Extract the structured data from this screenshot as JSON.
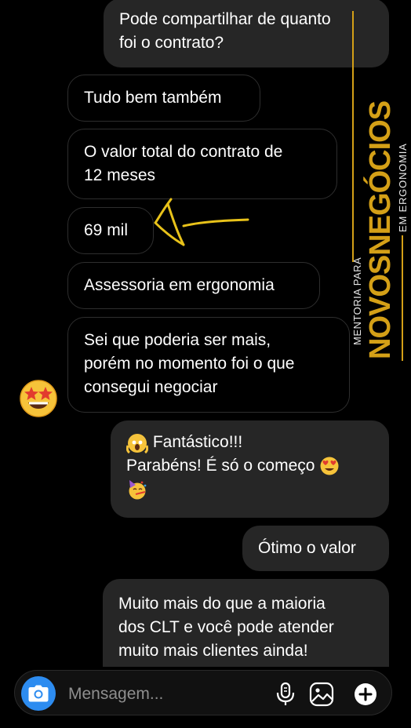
{
  "messages": [
    {
      "id": "m1",
      "side": "out",
      "lines": [
        "Pode compartilhar de quanto",
        "foi o contrato?"
      ]
    },
    {
      "id": "m2",
      "side": "in",
      "lines": [
        "Tudo bem também"
      ]
    },
    {
      "id": "m3",
      "side": "in",
      "lines": [
        "O valor total do contrato de",
        "12 meses"
      ]
    },
    {
      "id": "m4",
      "side": "in",
      "lines": [
        "69 mil"
      ]
    },
    {
      "id": "m5",
      "side": "in",
      "lines": [
        "Assessoria em ergonomia"
      ]
    },
    {
      "id": "m6",
      "side": "in",
      "lines": [
        "Sei que poderia ser mais,",
        "porém no momento foi o que",
        "consegui negociar"
      ],
      "reaction": "star-struck emoji"
    },
    {
      "id": "m7",
      "side": "out",
      "lines": [
        "Fantástico!!!",
        "Parabéns! É só o começo"
      ],
      "emojis": [
        "screaming-face",
        "heart-eyes",
        "party-face"
      ]
    },
    {
      "id": "m8",
      "side": "out",
      "lines": [
        "Ótimo o valor"
      ]
    },
    {
      "id": "m9",
      "side": "out",
      "lines": [
        "Muito mais do que a maioria",
        "dos CLT e você pode atender",
        "muito mais clientes ainda!"
      ]
    }
  ],
  "watermark": {
    "top_text": "MENTORIA PARA",
    "main_text": "NOVOSNEGÓCIOS",
    "bottom_text": "EM ERGONOMIA",
    "color": "#d4a017"
  },
  "annotation": {
    "type": "hand-drawn arrow",
    "color": "#e8c21a"
  },
  "composer": {
    "placeholder": "Mensagem...",
    "icons": [
      "camera-icon",
      "microphone-icon",
      "gallery-icon",
      "plus-icon"
    ],
    "accent": "#2d8cf0"
  },
  "colors": {
    "background": "#000000",
    "outgoing_bubble": "#262626",
    "incoming_border": "#2e2e2e"
  }
}
